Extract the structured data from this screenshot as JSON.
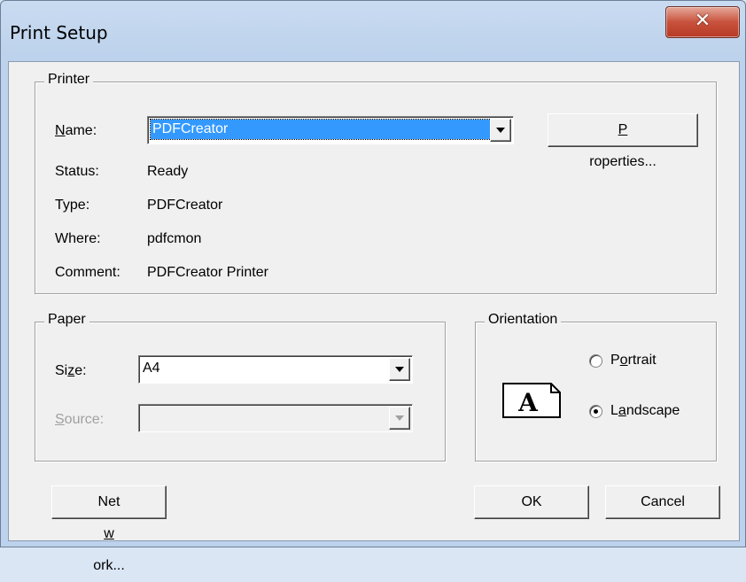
{
  "window": {
    "title": "Print Setup",
    "close_icon": "close-icon"
  },
  "printer": {
    "legend": "Printer",
    "name_label": "Name:",
    "name_value": "PDFCreator",
    "properties_button": "Properties...",
    "status_label": "Status:",
    "status_value": "Ready",
    "type_label": "Type:",
    "type_value": "PDFCreator",
    "where_label": "Where:",
    "where_value": "pdfcmon",
    "comment_label": "Comment:",
    "comment_value": "PDFCreator Printer"
  },
  "paper": {
    "legend": "Paper",
    "size_label": "Size:",
    "size_value": "A4",
    "source_label": "Source:",
    "source_value": ""
  },
  "orientation": {
    "legend": "Orientation",
    "icon_letter": "A",
    "portrait_label": "Portrait",
    "landscape_label": "Landscape",
    "selected": "landscape"
  },
  "buttons": {
    "network": "Network...",
    "ok": "OK",
    "cancel": "Cancel"
  }
}
